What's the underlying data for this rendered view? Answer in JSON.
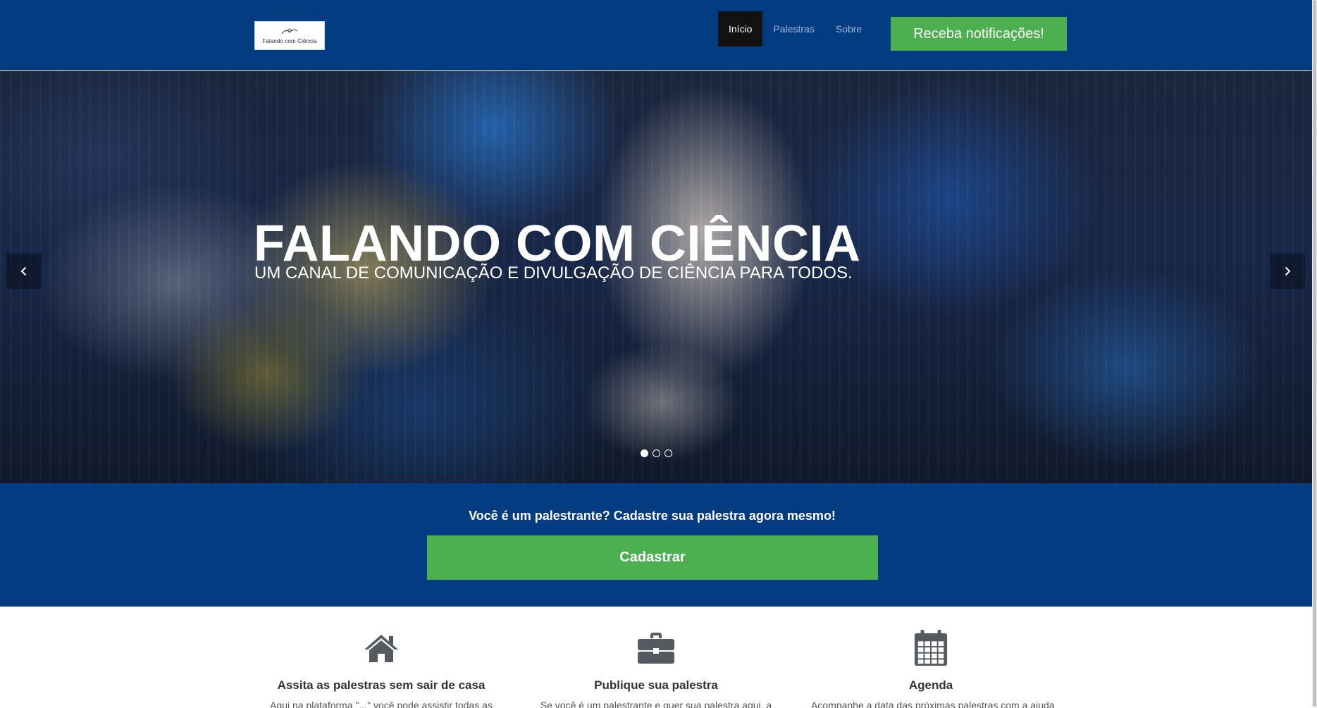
{
  "navbar": {
    "logo_text": "Falando com Ciência",
    "items": [
      {
        "label": "Início",
        "active": true
      },
      {
        "label": "Palestras",
        "active": false
      },
      {
        "label": "Sobre",
        "active": false
      }
    ],
    "notify_button": "Receba notificações!"
  },
  "hero": {
    "title": "FALANDO COM CIÊNCIA",
    "subtitle": "UM CANAL DE COMUNICAÇÃO E DIVULGAÇÃO DE CIÊNCIA PARA TODOS.",
    "prev_icon": "chevron-left-icon",
    "next_icon": "chevron-right-icon",
    "slides_count": 3,
    "active_slide": 1
  },
  "cta": {
    "text": "Você é um palestrante? Cadastre sua palestra agora mesmo!",
    "button": "Cadastrar"
  },
  "features": [
    {
      "icon": "home-icon",
      "title": "Assita as palestras sem sair de casa",
      "text": "Aqui na plataforma \"...\" você pode assistir todas as"
    },
    {
      "icon": "briefcase-icon",
      "title": "Publique sua palestra",
      "text": "Se você é um palestrante e quer sua palestra aqui, a"
    },
    {
      "icon": "calendar-icon",
      "title": "Agenda",
      "text": "Acompanhe a data das próximas palestras com a ajuda"
    }
  ],
  "colors": {
    "navbar_bg": "#043c82",
    "accent_green": "#4caf50",
    "active_nav_bg": "#121212",
    "icon_gray": "#555a60"
  }
}
